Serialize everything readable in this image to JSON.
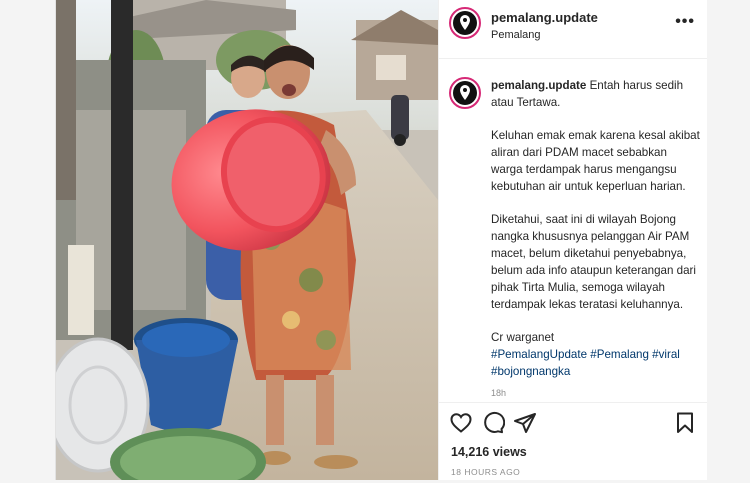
{
  "header": {
    "username": "pemalang.update",
    "location": "Pemalang",
    "more_icon": "more-dots-icon"
  },
  "caption": {
    "username": "pemalang.update",
    "text_1": "Entah harus sedih atau Tertawa.",
    "paragraph_2": "Keluhan emak emak karena kesal akibat aliran dari PDAM macet sebabkan warga terdampak harus mengangsu kebutuhan air untuk keperluan harian.",
    "paragraph_3": "Diketahui, saat ini di wilayah Bojong nangka khususnya pelanggan Air PAM macet, belum diketahui penyebabnya, belum ada info ataupun keterangan dari pihak Tirta Mulia, semoga wilayah terdampak lekas teratasi keluhannya.",
    "credit": "Cr warganet",
    "hashtags": [
      "#PemalangUpdate",
      "#Pemalang",
      "#viral",
      "#bojongnangka"
    ],
    "age": "18h"
  },
  "actions": {
    "icons": [
      "heart-icon",
      "comment-icon",
      "share-icon",
      "bookmark-icon"
    ],
    "views": "14,216 views",
    "timestamp": "18 HOURS AGO"
  },
  "colors": {
    "link": "#00376b",
    "muted": "#8e8e8e",
    "text": "#262626"
  }
}
